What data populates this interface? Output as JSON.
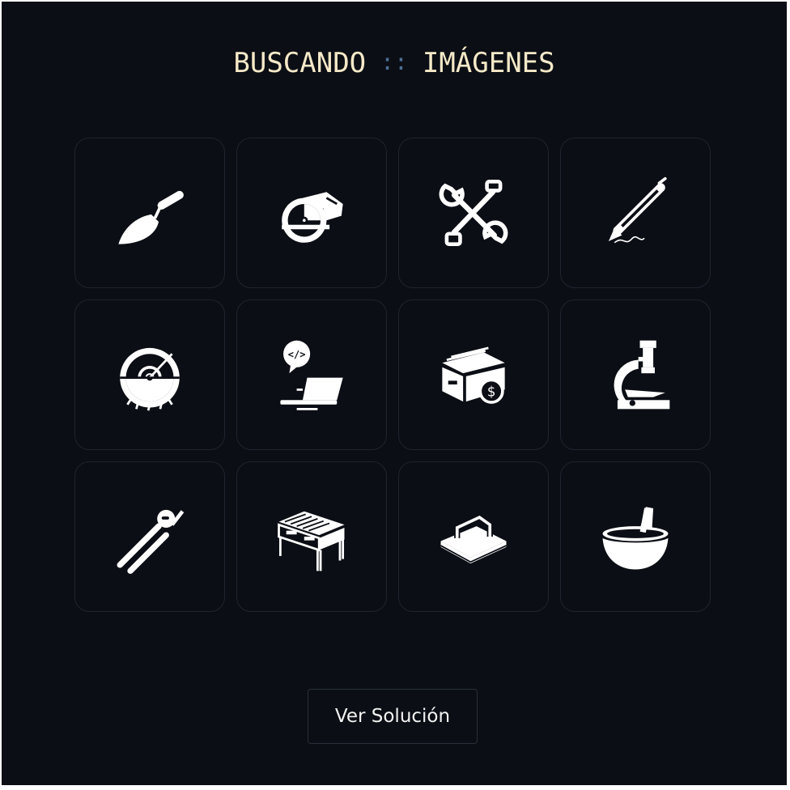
{
  "header": {
    "left": "BUSCANDO",
    "separator": "::",
    "right": "IMÁGENES"
  },
  "grid": {
    "tiles": [
      {
        "icon": "trowel-icon"
      },
      {
        "icon": "circular-saw-icon"
      },
      {
        "icon": "crossed-wrenches-icon"
      },
      {
        "icon": "pen-icon"
      },
      {
        "icon": "saw-blade-icon"
      },
      {
        "icon": "laptop-code-icon"
      },
      {
        "icon": "money-box-icon"
      },
      {
        "icon": "microscope-icon"
      },
      {
        "icon": "pliers-icon"
      },
      {
        "icon": "desk-icon"
      },
      {
        "icon": "float-trowel-icon"
      },
      {
        "icon": "mortar-pestle-icon"
      }
    ]
  },
  "footer": {
    "button_label": "Ver Solución"
  },
  "colors": {
    "background": "#0b0e14",
    "title": "#f5e9c8",
    "separator": "#4d6e94",
    "tile_border": "#1f2430",
    "icon": "#ffffff"
  }
}
